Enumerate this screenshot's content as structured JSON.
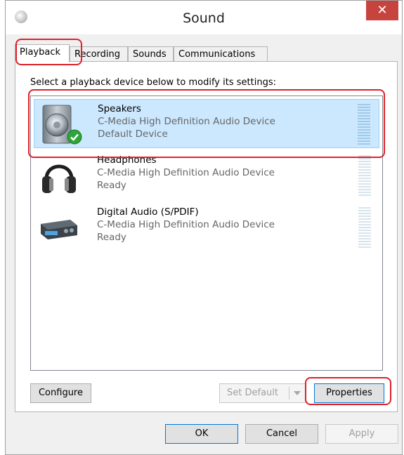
{
  "window": {
    "title": "Sound",
    "close_symbol": "✕",
    "app_icon": "speaker-icon",
    "close_color": "#c7433e"
  },
  "tabs": [
    {
      "label": "Playback",
      "active": true
    },
    {
      "label": "Recording",
      "active": false
    },
    {
      "label": "Sounds",
      "active": false
    },
    {
      "label": "Communications",
      "active": false
    }
  ],
  "playback": {
    "instruction": "Select a playback device below to modify its settings:",
    "devices": [
      {
        "name": "Speakers",
        "driver": "C-Media High Definition Audio Device",
        "status": "Default Device",
        "icon": "speaker-icon",
        "selected": true,
        "default_badge": "check-icon"
      },
      {
        "name": "Headphones",
        "driver": "C-Media High Definition Audio Device",
        "status": "Ready",
        "icon": "headphones-icon",
        "selected": false
      },
      {
        "name": "Digital Audio (S/PDIF)",
        "driver": "C-Media High Definition Audio Device",
        "status": "Ready",
        "icon": "digital-audio-icon",
        "selected": false
      }
    ],
    "buttons": {
      "configure": "Configure",
      "set_default": "Set Default",
      "properties": "Properties"
    }
  },
  "footer": {
    "ok": "OK",
    "cancel": "Cancel",
    "apply": "Apply"
  },
  "colors": {
    "selection": "#cce8ff",
    "highlight_outline": "#e0202a"
  }
}
